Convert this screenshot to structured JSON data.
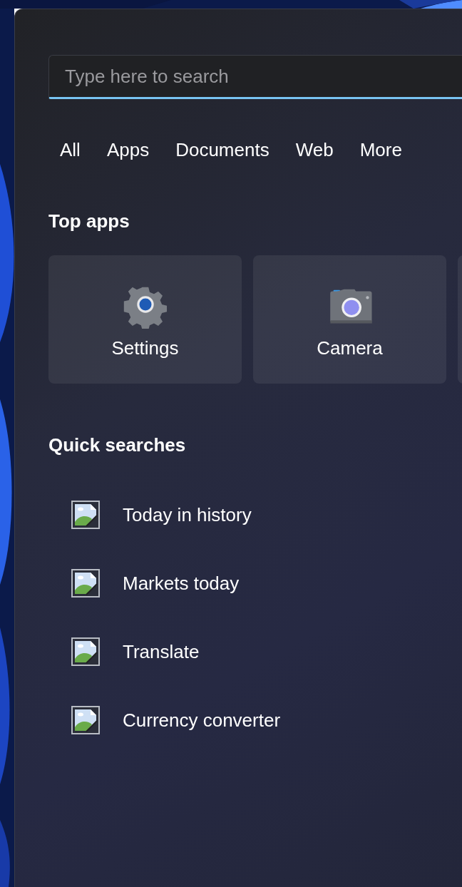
{
  "search": {
    "placeholder": "Type here to search"
  },
  "tabs": [
    {
      "label": "All"
    },
    {
      "label": "Apps"
    },
    {
      "label": "Documents"
    },
    {
      "label": "Web"
    },
    {
      "label": "More"
    }
  ],
  "top_apps": {
    "title": "Top apps",
    "apps": [
      {
        "label": "Settings",
        "kind": "settings"
      },
      {
        "label": "Camera",
        "kind": "camera"
      },
      {
        "kind": "partial"
      }
    ]
  },
  "quick_searches": {
    "title": "Quick searches",
    "items": [
      {
        "label": "Today in history"
      },
      {
        "label": "Markets today"
      },
      {
        "label": "Translate"
      },
      {
        "label": "Currency converter"
      }
    ]
  }
}
